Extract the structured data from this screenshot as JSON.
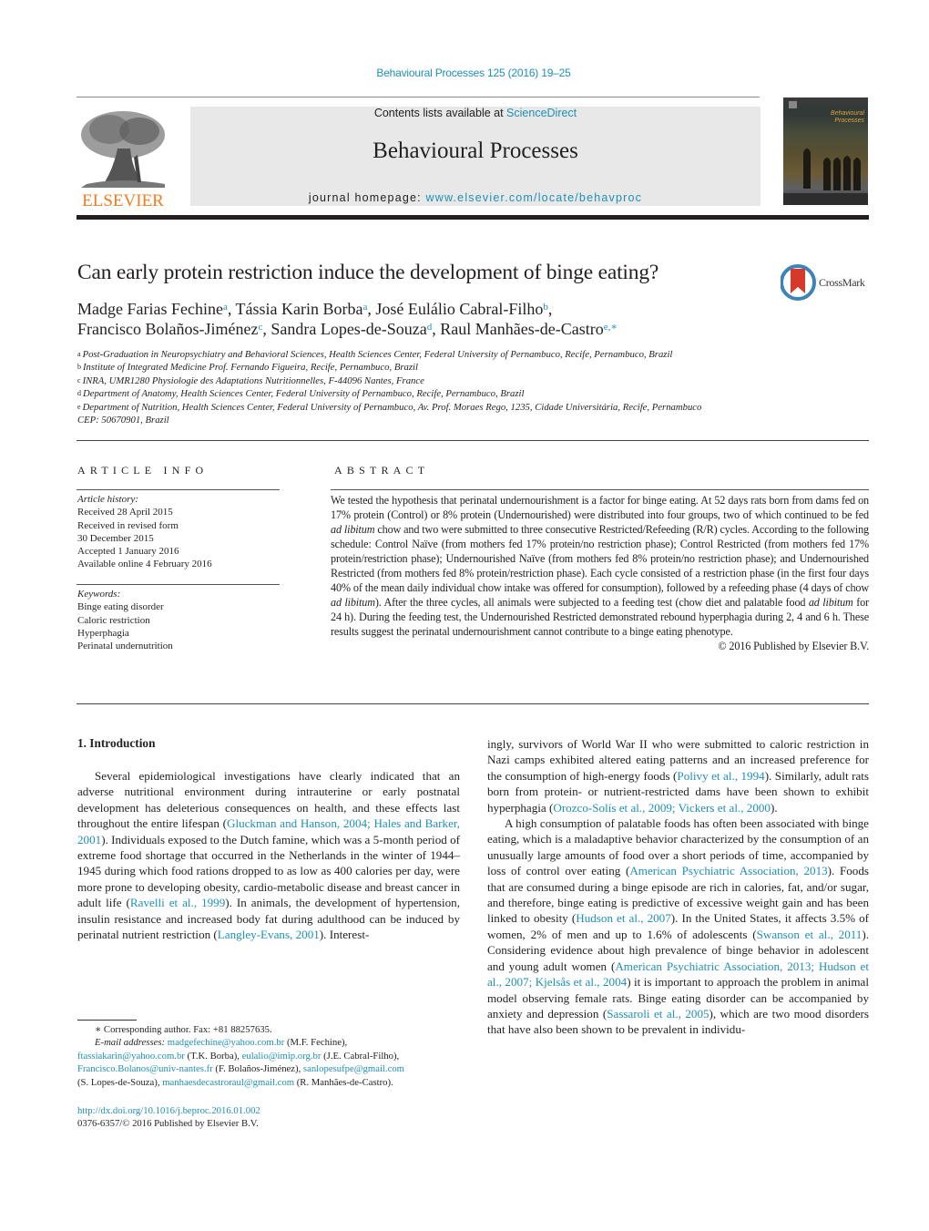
{
  "header": {
    "journal_ref": "Behavioural Processes 125 (2016) 19–25",
    "contents_prefix": "Contents lists available at ",
    "contents_link": "ScienceDirect",
    "journal_title": "Behavioural Processes",
    "homepage_prefix": "journal homepage: ",
    "homepage_link": "www.elsevier.com/locate/behavproc",
    "publisher_logo_text": "ELSEVIER",
    "cover_title_line1": "Behavioural",
    "cover_title_line2": "Processes",
    "colors": {
      "link": "#1f8fb5",
      "elsevier_orange": "#f07b22",
      "banner_bg": "#e8e8e8"
    }
  },
  "article": {
    "title": "Can early protein restriction induce the development of binge eating?",
    "crossmark_label": "CrossMark",
    "authors_line1": [
      {
        "name": "Madge Farias Fechine",
        "sup": "a",
        "sep": ", "
      },
      {
        "name": "Tássia Karin Borba",
        "sup": "a",
        "sep": ", "
      },
      {
        "name": "José Eulálio Cabral-Filho",
        "sup": "b",
        "sep": ","
      }
    ],
    "authors_line2": [
      {
        "name": "Francisco Bolaños-Jiménez",
        "sup": "c",
        "sep": ", "
      },
      {
        "name": "Sandra Lopes-de-Souza",
        "sup": "d",
        "sep": ", "
      },
      {
        "name": "Raul Manhães-de-Castro",
        "sup": "e,∗",
        "sep": ""
      }
    ],
    "affiliations": [
      {
        "sup": "a",
        "text": "Post-Graduation in Neuropsychiatry and Behavioral Sciences, Health Sciences Center, Federal University of Pernambuco, Recife, Pernambuco, Brazil"
      },
      {
        "sup": "b",
        "text": "Institute of Integrated Medicine Prof. Fernando Figueira, Recife, Pernambuco, Brazil"
      },
      {
        "sup": "c",
        "text": "INRA, UMR1280 Physiologie des Adaptations Nutritionnelles, F-44096 Nantes, France"
      },
      {
        "sup": "d",
        "text": "Department of Anatomy, Health Sciences Center, Federal University of Pernambuco, Recife, Pernambuco, Brazil"
      },
      {
        "sup": "e",
        "text": "Department of Nutrition, Health Sciences Center, Federal University of Pernambuco, Av. Prof. Moraes Rego, 1235, Cidade Universitária, Recife, Pernambuco"
      },
      {
        "sup": "",
        "text": "CEP: 50670901, Brazil"
      }
    ]
  },
  "article_info": {
    "heading": "ARTICLE INFO",
    "history_label": "Article history:",
    "history": [
      "Received 28 April 2015",
      "Received in revised form",
      "30 December 2015",
      "Accepted 1 January 2016",
      "Available online 4 February 2016"
    ],
    "keywords_label": "Keywords:",
    "keywords": [
      "Binge eating disorder",
      "Caloric restriction",
      "Hyperphagia",
      "Perinatal undernutrition"
    ]
  },
  "abstract": {
    "heading": "ABSTRACT",
    "part1": "We tested the hypothesis that perinatal undernourishment is a factor for binge eating. At 52 days rats born from dams fed on 17% protein (Control) or 8% protein (Undernourished) were distributed into four groups, two of which continued to be fed ",
    "italic1": "ad libitum",
    "part2": " chow and two were submitted to three consecutive Restricted/Refeeding (R/R) cycles. According to the following schedule: Control Naïve (from mothers fed 17% protein/no restriction phase); Control Restricted (from mothers fed 17% protein/restriction phase); Undernourished Naïve (from mothers fed 8% protein/no restriction phase); and Undernourished Restricted (from mothers fed 8% protein/restriction phase). Each cycle consisted of a restriction phase (in the first four days 40% of the mean daily individual chow intake was offered for consumption), followed by a refeeding phase (4 days of chow ",
    "italic2": "ad libitum",
    "part3": "). After the three cycles, all animals were subjected to a feeding test (chow diet and palatable food ",
    "italic3": "ad libitum",
    "part4": " for 24 h). During the feeding test, the Undernourished Restricted demonstrated rebound hyperphagia during 2, 4 and 6 h. These results suggest the perinatal undernourishment cannot contribute to a binge eating phenotype.",
    "copyright": "© 2016 Published by Elsevier B.V."
  },
  "body": {
    "section_heading": "1.  Introduction",
    "left_p1": {
      "t1": "Several epidemiological investigations have clearly indicated that an adverse nutritional environment during intrauterine or early postnatal development has deleterious consequences on health, and these effects last throughout the entire lifespan (",
      "c1": "Gluckman and Hanson, 2004; Hales and Barker, 2001",
      "t2": "). Individuals exposed to the Dutch famine, which was a 5-month period of extreme food shortage that occurred in the Netherlands in the winter of 1944–1945 during which food rations dropped to as low as 400 calories per day, were more prone to developing obesity, cardio-metabolic disease and breast cancer in adult life (",
      "c2": "Ravelli et al., 1999",
      "t3": "). In animals, the development of hypertension, insulin resistance and increased body fat during adulthood can be induced by perinatal nutrient restriction (",
      "c3": "Langley-Evans, 2001",
      "t4": "). Interest-"
    },
    "right_p1": {
      "t1": "ingly, survivors of World War II who were submitted to caloric restriction in Nazi camps exhibited altered eating patterns and an increased preference for the consumption of high-energy foods (",
      "c1": "Polivy et al., 1994",
      "t2": "). Similarly, adult rats born from protein- or nutrient-restricted dams have been shown to exhibit hyperphagia (",
      "c2": "Orozco-Solís et al., 2009; Vickers et al., 2000",
      "t3": ")."
    },
    "right_p2": {
      "t1": "A high consumption of palatable foods has often been associated with binge eating, which is a maladaptive behavior characterized by the consumption of an unusually large amounts of food over a short periods of time, accompanied by loss of control over eating (",
      "c1": "American Psychiatric Association, 2013",
      "t2": "). Foods that are consumed during a binge episode are rich in calories, fat, and/or sugar, and therefore, binge eating is predictive of excessive weight gain and has been linked to obesity (",
      "c2": "Hudson et al., 2007",
      "t3": "). In the United States, it affects 3.5% of women, 2% of men and up to 1.6% of adolescents (",
      "c3": "Swanson et al., 2011",
      "t4": "). Considering evidence about high prevalence of binge behavior in adolescent and young adult women (",
      "c4": "American Psychiatric Association, 2013; Hudson et al., 2007; Kjelsås et al., 2004",
      "t5": ") it is important to approach the problem in animal model observing female rats. Binge eating disorder can be accompanied by anxiety and depression (",
      "c5": "Sassaroli et al., 2005",
      "t6": "), which are two mood disorders that have also been shown to be prevalent in individu-"
    }
  },
  "footnotes": {
    "corresponding": "∗  Corresponding author. Fax: +81 88257635.",
    "email_label": "E-mail addresses: ",
    "emails": [
      {
        "email": "madgefechine@yahoo.com.br",
        "who": " (M.F. Fechine),"
      },
      {
        "email": "ftassiakarin@yahoo.com.br",
        "who": " (T.K. Borba), "
      },
      {
        "email": "eulalio@imip.org.br",
        "who": " (J.E. Cabral-Filho),"
      },
      {
        "email": "Francisco.Bolanos@univ-nantes.fr",
        "who": " (F. Bolaños-Jiménez), "
      },
      {
        "email": "sanlopesufpe@gmail.com",
        "who": ""
      },
      {
        "email": "manhaesdecastroraul@gmail.com",
        "who": " (R. Manhães-de-Castro)."
      }
    ],
    "lopes_who": "(S. Lopes-de-Souza), ",
    "doi": "http://dx.doi.org/10.1016/j.beproc.2016.01.002",
    "issn": "0376-6357/© 2016 Published by Elsevier B.V."
  }
}
